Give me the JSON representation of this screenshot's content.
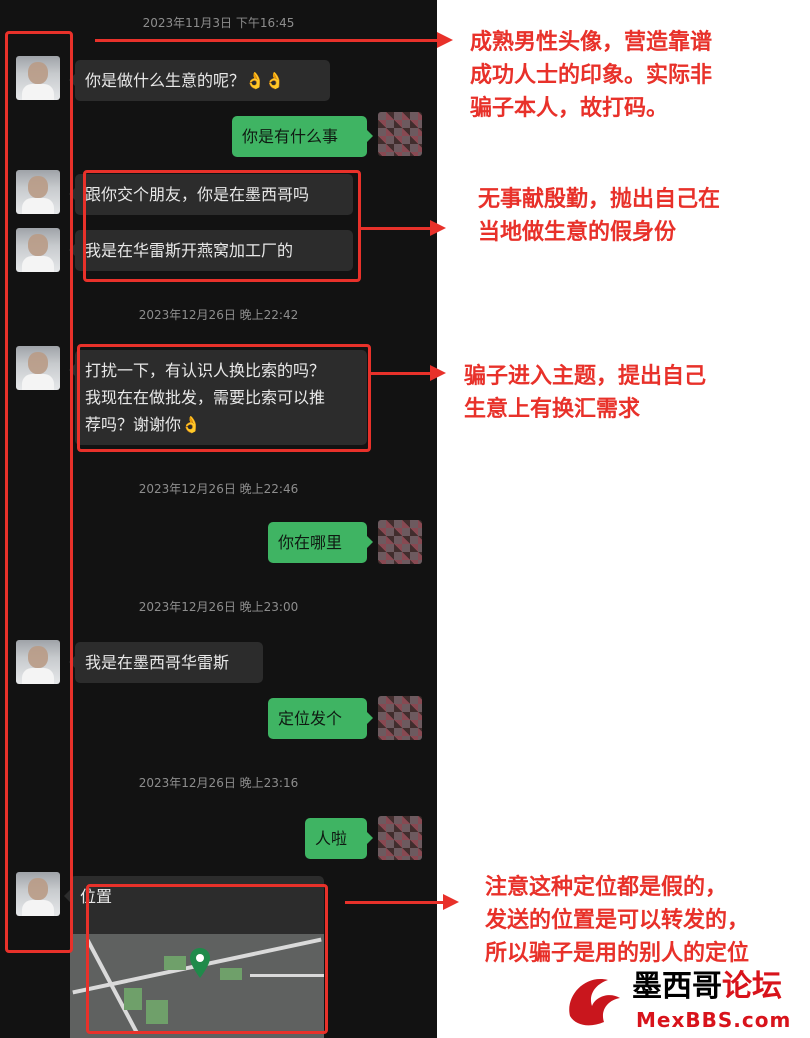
{
  "chat": {
    "timestamps": [
      "2023年11月3日 下午16:45",
      "2023年12月26日 晚上22:42",
      "2023年12月26日 晚上22:46",
      "2023年12月26日 晚上23:00",
      "2023年12月26日 晚上23:16"
    ],
    "messages": [
      {
        "from": "them",
        "text": "你是做什么生意的呢？👌👌"
      },
      {
        "from": "me",
        "text": "你是有什么事"
      },
      {
        "from": "them",
        "text": "跟你交个朋友，你是在墨西哥吗"
      },
      {
        "from": "them",
        "text": "我是在华雷斯开燕窝加工厂的"
      },
      {
        "from": "them",
        "text": "打扰一下，有认识人换比索的吗？\n我现在在做批发，需要比索可以推\n荐吗？谢谢你👌"
      },
      {
        "from": "me",
        "text": "你在哪里"
      },
      {
        "from": "them",
        "text": "我是在墨西哥华雷斯"
      },
      {
        "from": "me",
        "text": "定位发个"
      },
      {
        "from": "me",
        "text": "人啦"
      },
      {
        "from": "them",
        "text": "位置"
      }
    ]
  },
  "annotations": {
    "avatar_note": "成熟男性头像，营造靠谱\n成功人士的印象。实际非\n骗子本人，故打码。",
    "friend_note": "无事献殷勤，抛出自己在\n当地做生意的假身份",
    "topic_note": "骗子进入主题，提出自己\n生意上有换汇需求",
    "location_note": "注意这种定位都是假的，\n发送的位置是可以转发的，\n所以骗子是用的别人的定位"
  },
  "watermark": {
    "brand_cn_part1": "墨西哥",
    "brand_cn_part2": "论坛",
    "brand_en": "MexBBS.com"
  },
  "colors": {
    "annotation_red": "#e8312a",
    "chat_bg": "#121212",
    "in_bubble": "#2c2c2c",
    "out_bubble": "#3fb463"
  }
}
